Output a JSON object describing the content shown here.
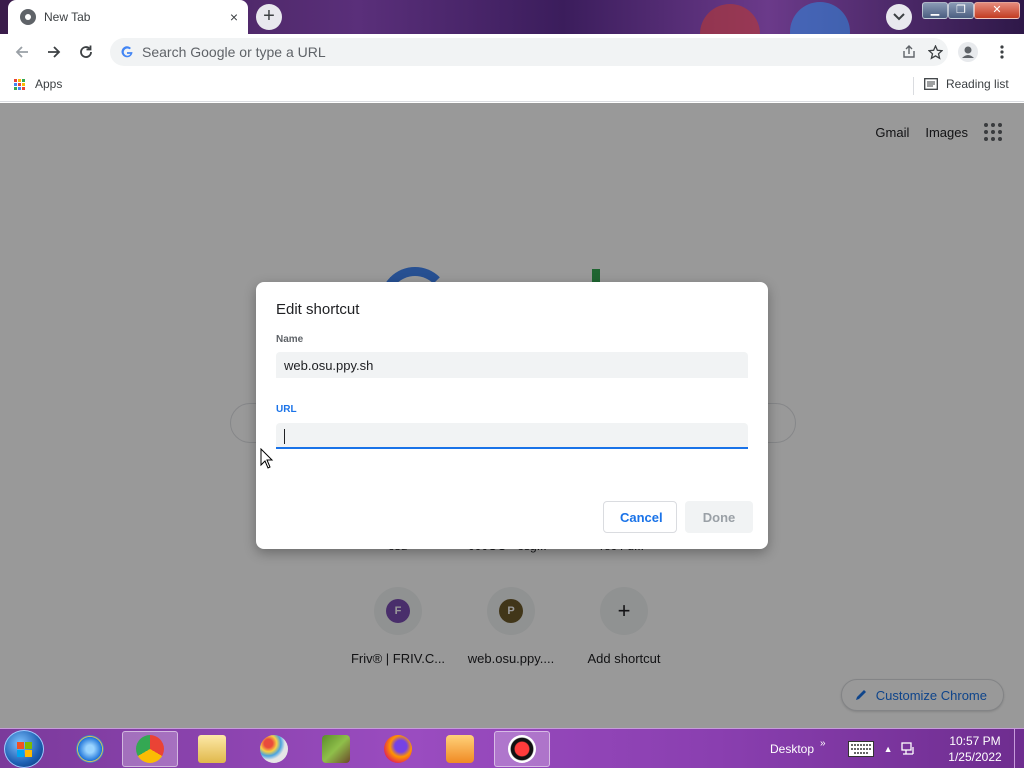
{
  "browser": {
    "tab_title": "New Tab",
    "tab_close": "×",
    "new_tab": "+",
    "omnibox_placeholder": "Search Google or type a URL",
    "bookmarks": {
      "apps_label": "Apps",
      "reading_list_label": "Reading list"
    },
    "icons": [
      "back-arrow-icon",
      "forward-arrow-icon",
      "reload-icon",
      "google-g-icon",
      "share-icon",
      "star-icon",
      "profile-icon",
      "more-vert-icon",
      "apps-grid-icon",
      "reading-list-icon"
    ]
  },
  "page": {
    "top_links": {
      "gmail": "Gmail",
      "images": "Images"
    },
    "shortcuts_row1_partial": [
      "osu",
      "000OO - osg...",
      "rec Fu..."
    ],
    "shortcuts": [
      {
        "initial": "F",
        "label": "Friv® | FRIV.C...",
        "color": "#7b4db3"
      },
      {
        "initial": "P",
        "label": "web.osu.ppy....",
        "color": "#6d5a2a"
      },
      {
        "initial": "+",
        "label": "Add shortcut",
        "color": "#202124"
      }
    ],
    "customize_label": "Customize Chrome"
  },
  "dialog": {
    "title": "Edit shortcut",
    "name_label": "Name",
    "name_value": "web.osu.ppy.sh",
    "url_label": "URL",
    "url_value": "",
    "cancel_label": "Cancel",
    "done_label": "Done"
  },
  "taskbar": {
    "apps": [
      "internet-explorer",
      "google-chrome",
      "file-explorer",
      "paint",
      "minecraft",
      "firefox",
      "media-player",
      "osu"
    ],
    "desktop_label": "Desktop",
    "time": "10:57 PM",
    "date": "1/25/2022"
  },
  "colors": {
    "accent": "#1a73e8",
    "taskbar": "#9a4cc0"
  }
}
